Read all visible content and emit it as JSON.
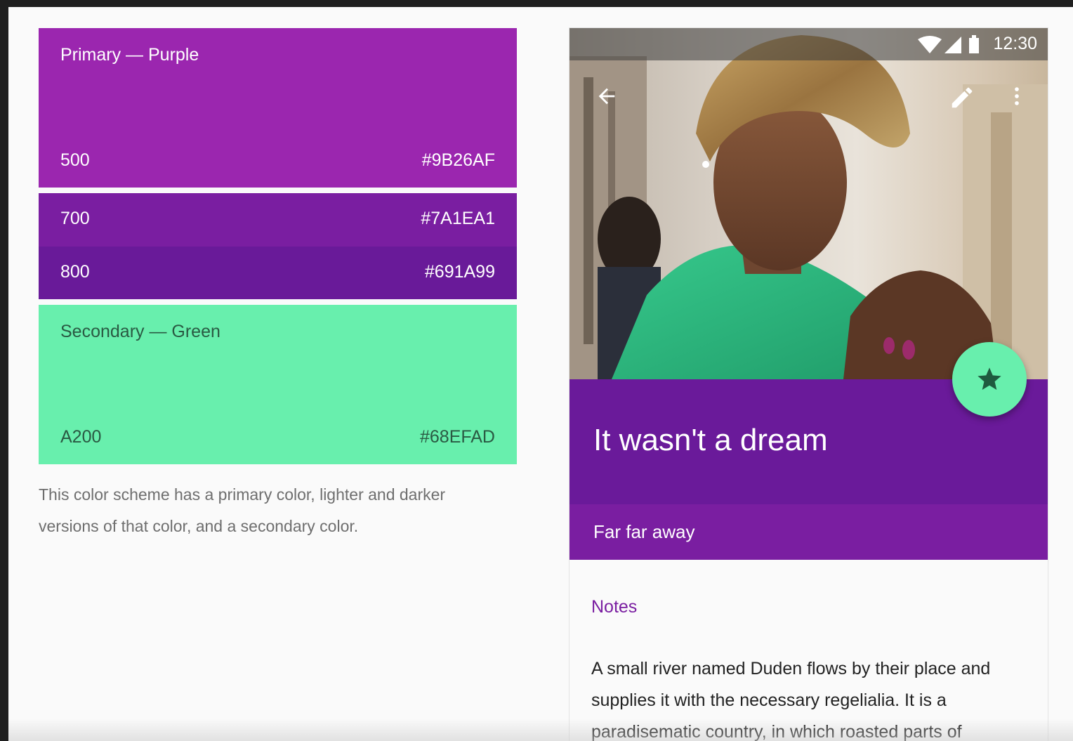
{
  "palette": {
    "primary": {
      "title": "Primary — Purple",
      "shades": [
        {
          "label": "500",
          "hex": "#9B26AF"
        },
        {
          "label": "700",
          "hex": "#7A1EA1"
        },
        {
          "label": "800",
          "hex": "#691A99"
        }
      ]
    },
    "secondary": {
      "title": "Secondary — Green",
      "shades": [
        {
          "label": "A200",
          "hex": "#68EFAD"
        }
      ]
    },
    "description": "This color scheme has a primary color, lighter and darker versions of that color, and a secondary color."
  },
  "phone": {
    "status_bar": {
      "time": "12:30",
      "icons": [
        "wifi-icon",
        "cellular-signal-icon",
        "battery-icon"
      ]
    },
    "toolbar": {
      "icons": [
        "back-arrow-icon",
        "edit-pencil-icon",
        "more-vert-icon"
      ]
    },
    "title": "It wasn't a dream",
    "subtitle": "Far far away",
    "fab_icon": "star-icon",
    "notes_heading": "Notes",
    "body": "A small river named Duden flows by their place and supplies it with the necessary regelialia. It is a paradisematic country, in which roasted parts of"
  },
  "colors": {
    "primary_500": "#9B26AF",
    "primary_700": "#7A1EA1",
    "primary_800": "#691A99",
    "secondary_a200": "#68EFAD",
    "description_text": "#6E6E6E",
    "body_text": "#222222"
  }
}
